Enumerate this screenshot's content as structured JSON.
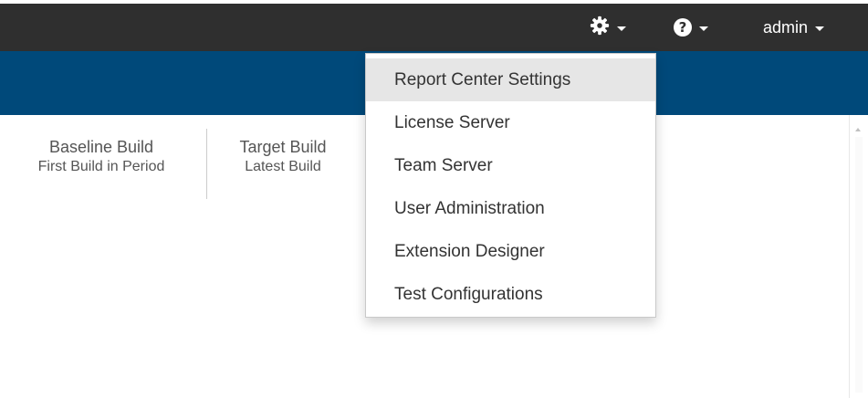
{
  "navbar": {
    "gear": {
      "icon": "gear-icon"
    },
    "help": {
      "icon": "help-icon",
      "glyph": "?"
    },
    "user": {
      "label": "admin"
    }
  },
  "builds": {
    "baseline": {
      "title": "Baseline Build",
      "subtitle": "First Build in Period"
    },
    "target": {
      "title": "Target Build",
      "subtitle": "Latest Build"
    }
  },
  "settings_menu": {
    "items": [
      {
        "label": "Report Center Settings",
        "active": true
      },
      {
        "label": "License Server"
      },
      {
        "label": "Team Server"
      },
      {
        "label": "User Administration"
      },
      {
        "label": "Extension Designer"
      },
      {
        "label": "Test Configurations"
      }
    ]
  },
  "colors": {
    "navbar_bg": "#2f2f2f",
    "blue_band": "#00497a",
    "menu_active": "#e6e6e6"
  }
}
